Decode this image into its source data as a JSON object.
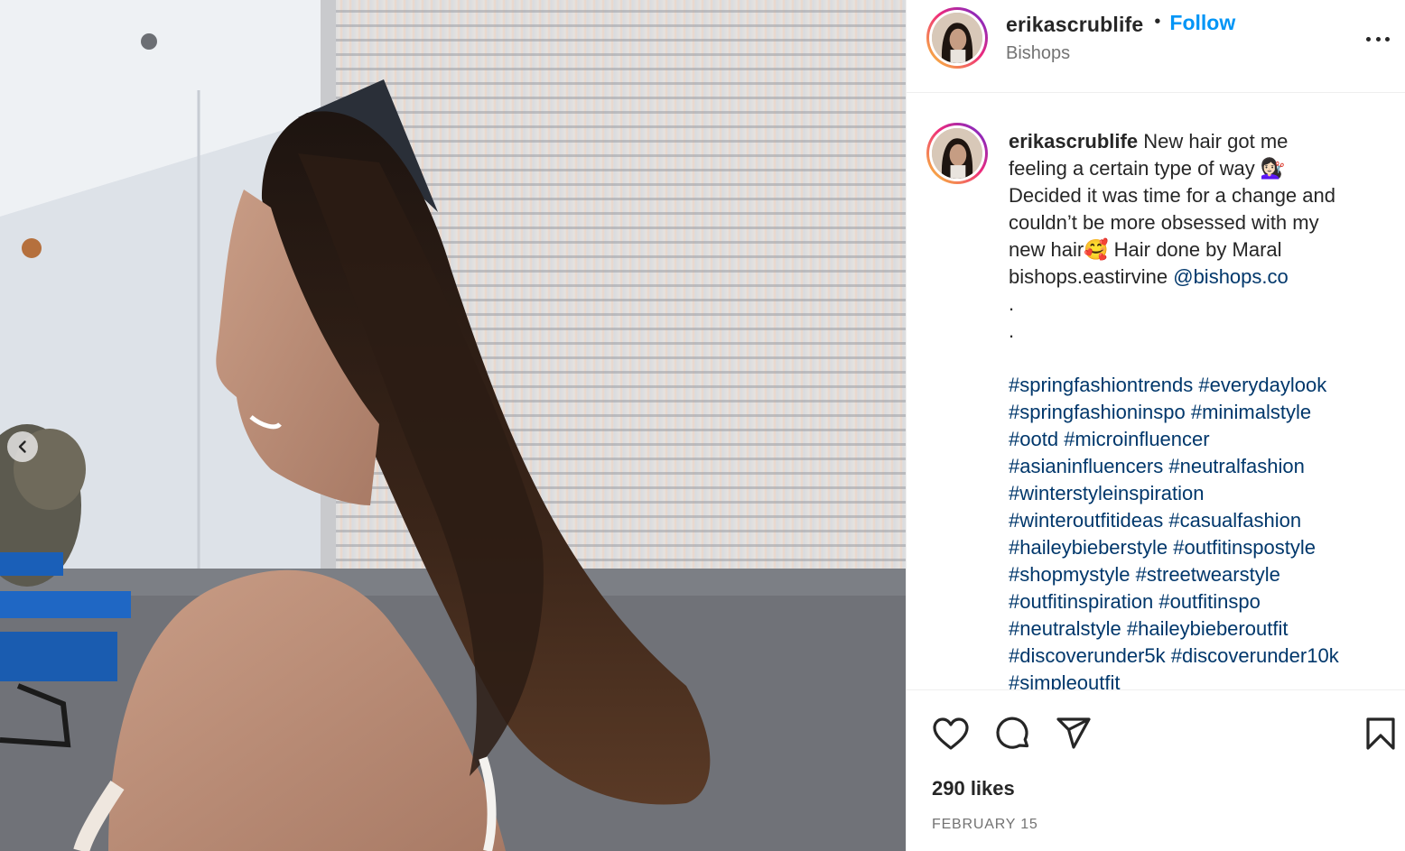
{
  "post": {
    "username": "erikascrublife",
    "separator": "•",
    "follow_label": "Follow",
    "location": "Bishops",
    "more_icon": "more-options-icon"
  },
  "caption": {
    "username": "erikascrublife",
    "lines": [
      "New hair got me",
      "feeling a certain type of way 💇🏻‍♀️",
      "Decided it was time for a change and",
      "couldn’t be more obsessed with my",
      "new hair🥰 Hair done by Maral",
      "bishops.eastirvine",
      ".",
      "."
    ],
    "mention": "@bishops.co"
  },
  "hashtags": [
    [
      "#springfashiontrends",
      "#everydaylook"
    ],
    [
      "#springfashioninspo",
      "#minimalstyle"
    ],
    [
      "#ootd",
      "#microinfluencer"
    ],
    [
      "#asianinfluencers",
      "#neutralfashion"
    ],
    [
      "#winterstyleinspiration"
    ],
    [
      "#winteroutfitideas",
      "#casualfashion"
    ],
    [
      "#haileybieberstyle",
      "#outfitinspostyle"
    ],
    [
      "#shopmystyle",
      "#streetwearstyle"
    ],
    [
      "#outfitinspiration",
      "#outfitinspo"
    ],
    [
      "#neutralstyle",
      "#haileybieberoutfit"
    ],
    [
      "#discoverunder5k",
      "#discoverunder10k"
    ],
    [
      "#simpleoutfit"
    ]
  ],
  "actions": {
    "icons": [
      "heart-icon",
      "comment-icon",
      "share-icon",
      "bookmark-icon"
    ]
  },
  "likes": "290 likes",
  "date": "FEBRUARY 15",
  "colors": {
    "link": "#00376b",
    "follow": "#0095f6",
    "text": "#262626",
    "muted": "#737373",
    "divider": "#efefef",
    "ring_start": "#f9ce34",
    "ring_mid": "#ee2a7b",
    "ring_end": "#6228d7"
  }
}
